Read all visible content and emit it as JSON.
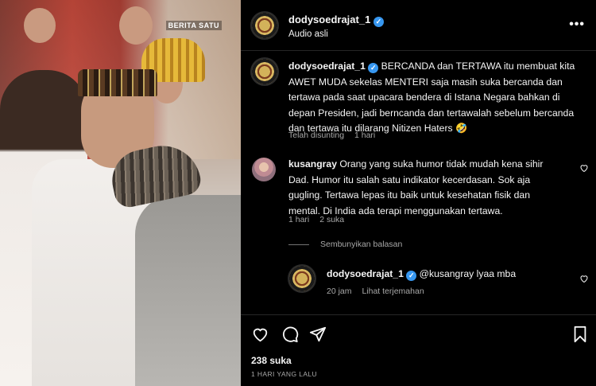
{
  "media": {
    "watermark": "BERITA SATU"
  },
  "header": {
    "username": "dodysoedrajat_1",
    "audio": "Audio asli",
    "more": "•••"
  },
  "caption": {
    "username": "dodysoedrajat_1",
    "text": "BERCANDA dan TERTAWA itu membuat kita AWET MUDA sekelas MENTERI saja masih suka bercanda dan tertawa pada saat upacara bendera di Istana Negara bahkan di depan Presiden, jadi berncanda dan tertawalah sebelum bercanda dan tertawa itu dilarang Nitizen Haters 🤣",
    "edited": "Telah disunting",
    "time": "1 hari"
  },
  "comment": {
    "username": "kusangray",
    "text": "Orang yang suka humor tidak mudah kena sihir Dad. Humor itu salah satu indikator kecerdasan. Sok aja gugling. Tertawa lepas itu baik untuk kesehatan fisik dan mental. Di India ada terapi menggunakan tertawa.",
    "time": "1 hari",
    "likes": "2 suka"
  },
  "hide_replies": "Sembunyikan balasan",
  "reply": {
    "username": "dodysoedrajat_1",
    "mention": "@kusangray",
    "text": "lyaa mba",
    "time": "20 jam",
    "translate": "Lihat terjemahan"
  },
  "footer": {
    "likes": "238 suka",
    "date": "1 HARI YANG LALU"
  },
  "icons": [
    "heart-icon",
    "comment-icon",
    "share-icon",
    "bookmark-icon",
    "verified-icon",
    "more-icon"
  ],
  "colors": {
    "background": "#000000",
    "text": "#f5f5f5",
    "secondary": "#a8a8a8",
    "verified": "#3797f0",
    "divider": "#262626"
  }
}
